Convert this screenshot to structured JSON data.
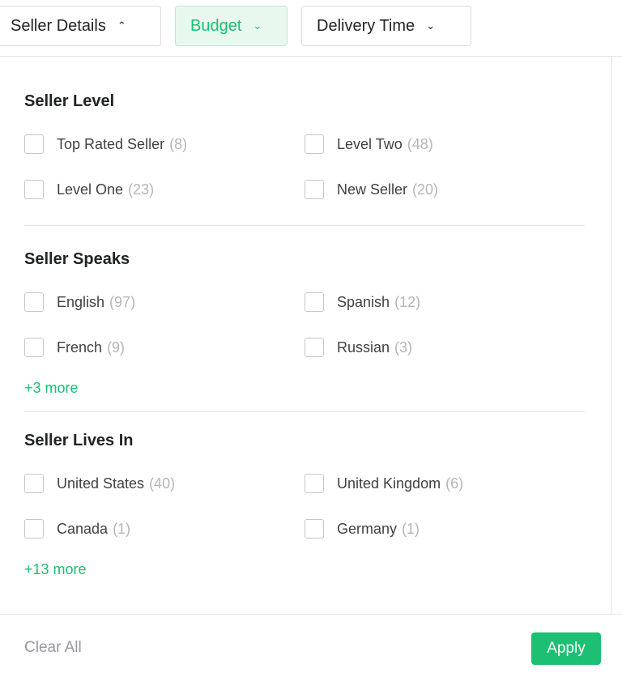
{
  "toolbar": {
    "buttons": [
      {
        "label": "Seller Details",
        "chevron": "chevron-up-icon"
      },
      {
        "label": "Budget",
        "chevron": "chevron-down-icon"
      },
      {
        "label": "Delivery Time",
        "chevron": "chevron-down-icon"
      }
    ]
  },
  "sections": [
    {
      "title": "Seller Level",
      "options": [
        {
          "label": "Top Rated Seller",
          "count": "(8)"
        },
        {
          "label": "Level Two",
          "count": "(48)"
        },
        {
          "label": "Level One",
          "count": "(23)"
        },
        {
          "label": "New Seller",
          "count": "(20)"
        }
      ]
    },
    {
      "title": "Seller Speaks",
      "options": [
        {
          "label": "English",
          "count": "(97)"
        },
        {
          "label": "Spanish",
          "count": "(12)"
        },
        {
          "label": "French",
          "count": "(9)"
        },
        {
          "label": "Russian",
          "count": "(3)"
        }
      ],
      "more": "+3 more"
    },
    {
      "title": "Seller Lives In",
      "options": [
        {
          "label": "United States",
          "count": "(40)"
        },
        {
          "label": "United Kingdom",
          "count": "(6)"
        },
        {
          "label": "Canada",
          "count": "(1)"
        },
        {
          "label": "Germany",
          "count": "(1)"
        }
      ],
      "more": "+13 more"
    }
  ],
  "footer": {
    "clear": "Clear All",
    "apply": "Apply"
  },
  "colors": {
    "accent": "#1dbf73",
    "accent_bg": "#e8f8ef"
  }
}
